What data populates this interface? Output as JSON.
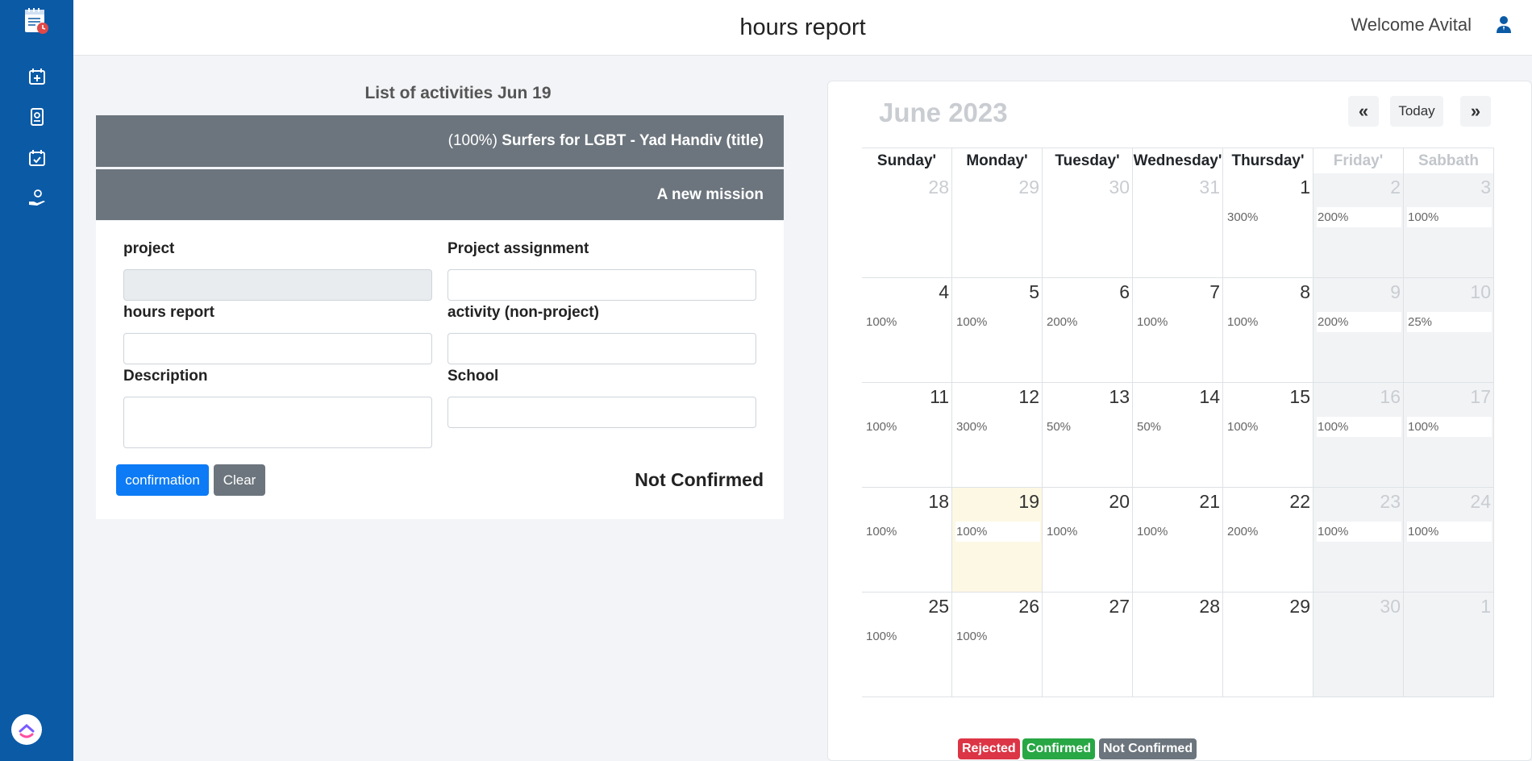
{
  "header": {
    "title": "hours report",
    "welcome": "Welcome Avital"
  },
  "sidebar": {
    "items": [
      {
        "icon": "calendar-plus-icon"
      },
      {
        "icon": "id-badge-icon"
      },
      {
        "icon": "calendar-check-icon"
      },
      {
        "icon": "hand-coin-icon"
      }
    ]
  },
  "activities": {
    "title": "List of activities Jun 19",
    "item1_percent": "(100%) ",
    "item1_title": "Surfers for LGBT - Yad Handiv (title)",
    "item2_title": "A new mission"
  },
  "form": {
    "project_label": "project",
    "assignment_label": "Project assignment",
    "hours_label": "hours report",
    "activity_label": "activity (non-project)",
    "description_label": "Description",
    "school_label": "School",
    "confirm_button": "confirmation",
    "clear_button": "Clear",
    "status": "Not Confirmed"
  },
  "calendar": {
    "title": "June 2023",
    "prev": "«",
    "today": "Today",
    "next": "»",
    "days": [
      "Sunday'",
      "Monday'",
      "Tuesday'",
      "Wednesday'",
      "Thursday'",
      "Friday'",
      "Sabbath"
    ],
    "weeks": [
      [
        {
          "d": "28",
          "e": "",
          "m": true
        },
        {
          "d": "29",
          "e": "",
          "m": true
        },
        {
          "d": "30",
          "e": "",
          "m": true
        },
        {
          "d": "31",
          "e": "",
          "m": true
        },
        {
          "d": "1",
          "e": "300%"
        },
        {
          "d": "2",
          "e": "200%"
        },
        {
          "d": "3",
          "e": "100%"
        }
      ],
      [
        {
          "d": "4",
          "e": "100%"
        },
        {
          "d": "5",
          "e": "100%"
        },
        {
          "d": "6",
          "e": "200%"
        },
        {
          "d": "7",
          "e": "100%"
        },
        {
          "d": "8",
          "e": "100%"
        },
        {
          "d": "9",
          "e": "200%"
        },
        {
          "d": "10",
          "e": "25%"
        }
      ],
      [
        {
          "d": "11",
          "e": "100%"
        },
        {
          "d": "12",
          "e": "300%"
        },
        {
          "d": "13",
          "e": "50%"
        },
        {
          "d": "14",
          "e": "50%"
        },
        {
          "d": "15",
          "e": "100%"
        },
        {
          "d": "16",
          "e": "100%"
        },
        {
          "d": "17",
          "e": "100%"
        }
      ],
      [
        {
          "d": "18",
          "e": "100%"
        },
        {
          "d": "19",
          "e": "100%",
          "today": true
        },
        {
          "d": "20",
          "e": "100%"
        },
        {
          "d": "21",
          "e": "100%"
        },
        {
          "d": "22",
          "e": "200%"
        },
        {
          "d": "23",
          "e": "100%"
        },
        {
          "d": "24",
          "e": "100%"
        }
      ],
      [
        {
          "d": "25",
          "e": "100%"
        },
        {
          "d": "26",
          "e": "100%"
        },
        {
          "d": "27",
          "e": ""
        },
        {
          "d": "28",
          "e": ""
        },
        {
          "d": "29",
          "e": ""
        },
        {
          "d": "30",
          "e": ""
        },
        {
          "d": "1",
          "e": "",
          "m": true
        }
      ]
    ]
  },
  "legend": [
    {
      "label": "Rejected",
      "color": "#dc3545"
    },
    {
      "label": "Confirmed",
      "color": "#28a745"
    },
    {
      "label": "Not Confirmed",
      "color": "#6c757d"
    }
  ],
  "colors": {
    "sidebar": "#0b5aa6",
    "primary": "#0d7bf5",
    "secondary": "#6c757d"
  }
}
